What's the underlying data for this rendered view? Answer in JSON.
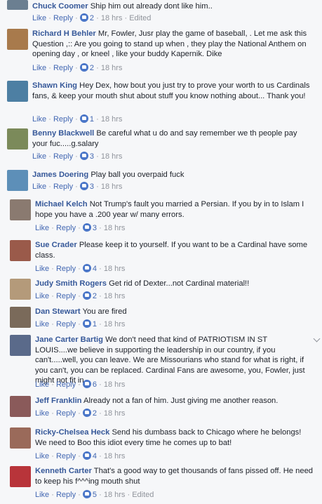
{
  "labels": {
    "like": "Like",
    "reply": "Reply",
    "sep": "·"
  },
  "comments": [
    {
      "name": "Chuck Coomer",
      "text": "Ship him out already dont like him..",
      "likes": "2",
      "time": "18 hrs",
      "edited": "Edited",
      "avatar_color": "#6b7f91"
    },
    {
      "name": "Richard H Behler",
      "text": "Mr, Fowler, Jusr play the game of baseball, . Let me ask this Question ,:: Are you going to stand up when , they play the National Anthem on opening day , or kneel , like your buddy Kapernik. Dike",
      "likes": "2",
      "time": "18 hrs",
      "avatar_color": "#a87a4c"
    },
    {
      "name": "Shawn King",
      "text": "Hey Dex, how bout you just try to prove your worth to us Cardinals fans, & keep your mouth shut about stuff you know nothing about... Thank you!",
      "likes": "1",
      "time": "18 hrs",
      "avatar_color": "#4d7fa3"
    },
    {
      "name": "Benny Blackwell",
      "text": "Be careful what u do and say remember we th people pay your fuc.....g.salary",
      "likes": "3",
      "time": "18 hrs",
      "avatar_color": "#7b8a5a"
    },
    {
      "name": "James Doering",
      "text": "Play ball you overpaid fuck",
      "likes": "3",
      "time": "18 hrs",
      "avatar_color": "#5d8fb8"
    },
    {
      "name": "Michael Kelch",
      "text": "Not Trump's fault you married a Persian. If you by in to Islam I hope you have a .200 year w/ many errors.",
      "likes": "3",
      "time": "18 hrs",
      "avatar_color": "#8a7a70"
    },
    {
      "name": "Sue Crader",
      "text": "Please keep it to yourself. If you want to be a Cardinal have some class.",
      "likes": "4",
      "time": "18 hrs",
      "avatar_color": "#9a5a4a"
    },
    {
      "name": "Judy Smith Rogers",
      "text": "Get rid of Dexter...not Cardinal material!!",
      "likes": "2",
      "time": "18 hrs",
      "avatar_color": "#b49a7a"
    },
    {
      "name": "Dan Stewart",
      "text": "You are fired",
      "likes": "1",
      "time": "18 hrs",
      "avatar_color": "#7a6a5a"
    },
    {
      "name": "Jane Carter Bartig",
      "text": "We don't need that kind of PATRIOTISM IN ST LOUIS....we believe in supporting the leadership in our country, if you can't.....well, you can leave. We are Missourians who stand for what is right, if you can't, you can be replaced. Cardinal Fans are awesome, you, Fowler, just might not fit in.",
      "likes": "6",
      "time": "18 hrs",
      "avatar_color": "#5a6a8a"
    },
    {
      "name": "Jeff Franklin",
      "text": "Already not a fan of him. Just giving me another reason.",
      "likes": "2",
      "time": "18 hrs",
      "avatar_color": "#8a5a5a"
    },
    {
      "name": "Ricky-Chelsea Heck",
      "text": "Send his dumbass back to Chicago where he belongs! We need to Boo this idiot every time he comes up to bat!",
      "likes": "4",
      "time": "18 hrs",
      "avatar_color": "#9a6a5a"
    },
    {
      "name": "Kenneth Carter",
      "text": "That's a good way to get thousands of fans pissed off. He need to keep his f^^^ing mouth shut",
      "likes": "5",
      "time": "18 hrs",
      "edited": "Edited",
      "avatar_color": "#b8343a"
    }
  ]
}
